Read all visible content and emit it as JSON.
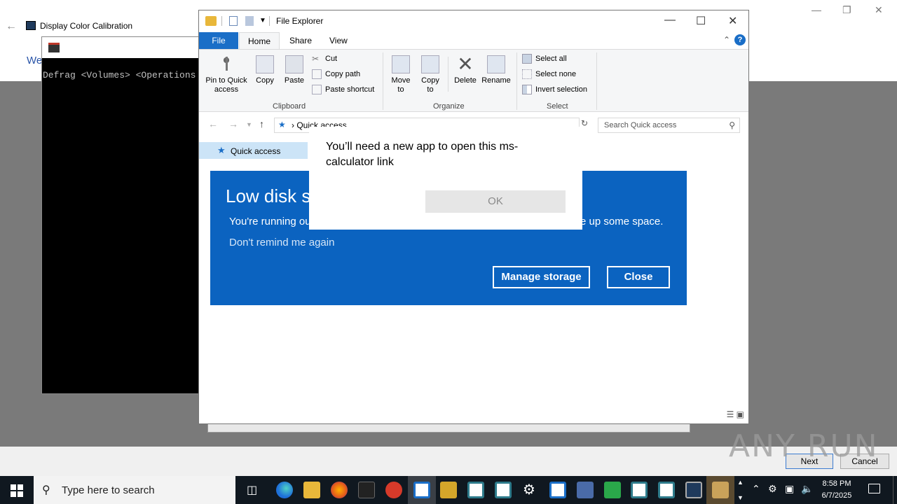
{
  "calibration": {
    "title": "Display Color Calibration",
    "heading_partial": "We",
    "next_label": "Next",
    "cancel_label": "Cancel"
  },
  "cmd": {
    "text": "Defrag <Volumes> <Operations"
  },
  "explorer": {
    "title": "File Explorer",
    "tabs": [
      "File",
      "Home",
      "Share",
      "View"
    ],
    "active_tab": "Home",
    "ribbon": {
      "clipboard": {
        "label": "Clipboard",
        "pin": "Pin to Quick access",
        "copy": "Copy",
        "paste": "Paste",
        "cut": "Cut",
        "copy_path": "Copy path",
        "paste_shortcut": "Paste shortcut"
      },
      "organize": {
        "label": "Organize",
        "move_to": "Move to",
        "copy_to": "Copy to",
        "delete": "Delete",
        "rename": "Rename"
      },
      "select": {
        "label": "Select",
        "select_all": "Select all",
        "select_none": "Select none",
        "invert": "Invert selection"
      }
    },
    "address": "Quick access",
    "search_placeholder": "Search Quick access",
    "sidebar_quick_access": "Quick access"
  },
  "low_disk": {
    "title": "Low disk s",
    "message_left": "You're running ou",
    "message_right": "e up some space.",
    "dont_remind": "Don't remind me again",
    "manage_label": "Manage storage",
    "close_label": "Close"
  },
  "modal": {
    "message": "You’ll need a new app to open this ms-calculator link",
    "ok_label": "OK"
  },
  "taskbar": {
    "search_placeholder": "Type here to search",
    "time": "8:58 PM",
    "date": "6/7/2025"
  },
  "watermark": "ANY RUN",
  "colors": {
    "accent_blue": "#0b63c0",
    "taskbar": "#101820",
    "file_tab": "#1a6ec7"
  }
}
